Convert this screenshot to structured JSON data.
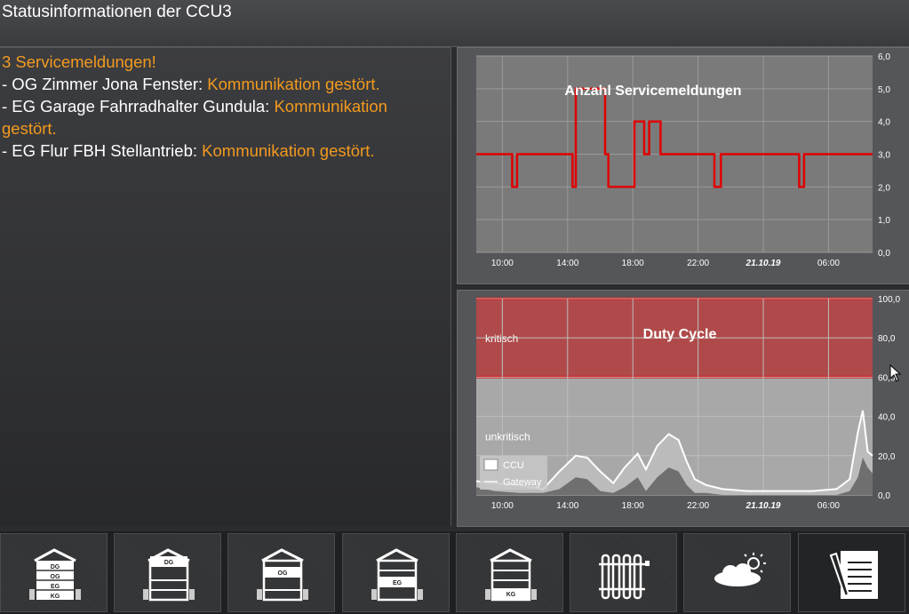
{
  "header": {
    "title": "Statusinformationen der CCU3"
  },
  "service": {
    "heading": "3 Servicemeldungen!",
    "items": [
      {
        "prefix": "- OG Zimmer Jona Fenster: ",
        "status": "Kommunikation gestört."
      },
      {
        "prefix": "- EG Garage Fahrradhalter Gundula: ",
        "status": "Kommunikation gestört."
      },
      {
        "prefix": "- EG Flur FBH Stellantrieb: ",
        "status": "Kommunikation gestört."
      }
    ]
  },
  "colors": {
    "accent": "#f39a1e",
    "line": "#e00000",
    "critical_zone": "#b04a4a",
    "ccu_line": "#ffffff",
    "gateway_area": "#6f6f6f"
  },
  "chart_data": [
    {
      "type": "line",
      "title": "Anzahl Servicemeldungen",
      "x_tick_labels": [
        "10:00",
        "14:00",
        "18:00",
        "22:00",
        "21.10.19",
        "06:00"
      ],
      "y_tick_labels": [
        "0,0",
        "1,0",
        "2,0",
        "3,0",
        "4,0",
        "5,0",
        "6,0"
      ],
      "ylim": [
        0,
        6
      ],
      "xlim": [
        8.4,
        32.7
      ],
      "grid": true,
      "series": [
        {
          "x": [
            8.4,
            10.6,
            10.6,
            10.9,
            10.9,
            14.3,
            14.3,
            14.5,
            14.5,
            16.3,
            16.3,
            16.5,
            16.5,
            18.1,
            18.1,
            18.7,
            18.7,
            19.0,
            19.0,
            19.7,
            19.7,
            19.8,
            19.8,
            23.0,
            23.0,
            23.4,
            23.4,
            28.2,
            28.2,
            28.5,
            28.5,
            32.7
          ],
          "y": [
            3,
            3,
            2,
            2,
            3,
            3,
            2,
            2,
            5,
            5,
            3,
            3,
            2,
            2,
            4,
            4,
            3,
            3,
            4,
            4,
            3,
            3,
            3,
            3,
            2,
            2,
            3,
            3,
            2,
            2,
            3,
            3
          ]
        }
      ]
    },
    {
      "type": "area",
      "title": "Duty Cycle",
      "zones": [
        {
          "label": "kritisch",
          "from": 60,
          "to": 100
        },
        {
          "label": "unkritisch",
          "from": 0,
          "to": 60
        }
      ],
      "x_tick_labels": [
        "10:00",
        "14:00",
        "18:00",
        "22:00",
        "21.10.19",
        "06:00"
      ],
      "y_tick_labels": [
        "0,0",
        "20,0",
        "40,0",
        "60,0",
        "80,0",
        "100,0"
      ],
      "ylim": [
        0,
        100
      ],
      "xlim": [
        8.4,
        32.7
      ],
      "legend": "bottom-left",
      "series": [
        {
          "name": "CCU",
          "x": [
            8.4,
            9.5,
            11,
            12.5,
            13.5,
            14.5,
            15.2,
            16,
            16.8,
            17.5,
            18.3,
            18.8,
            19.5,
            20.2,
            20.8,
            21.3,
            21.8,
            22.5,
            23.5,
            25,
            27,
            29,
            30.5,
            31.3,
            31.8,
            32.1,
            32.4,
            32.7
          ],
          "y": [
            7,
            6,
            5,
            3,
            12,
            20,
            19,
            12,
            6,
            14,
            21,
            13,
            25,
            31,
            28,
            17,
            8,
            5,
            3,
            2,
            2,
            2,
            3,
            8,
            32,
            43,
            22,
            20
          ]
        },
        {
          "name": "Gateway",
          "x": [
            8.4,
            9.5,
            11,
            12.5,
            13.5,
            14.5,
            15.2,
            16,
            16.8,
            17.5,
            18.3,
            18.8,
            19.5,
            20.2,
            20.8,
            21.3,
            21.8,
            22.5,
            23.5,
            25,
            27,
            29,
            30.5,
            31.3,
            31.8,
            32.1,
            32.4,
            32.7
          ],
          "y": [
            4,
            2,
            1,
            1,
            3,
            9,
            8,
            2,
            1,
            4,
            9,
            2,
            9,
            14,
            12,
            5,
            1,
            1,
            0,
            0,
            0,
            0,
            0,
            2,
            9,
            19,
            14,
            11
          ]
        }
      ]
    }
  ],
  "nav": [
    {
      "icon": "house-all-floors-icon",
      "floors": [
        "DG",
        "OG",
        "EG",
        "KG"
      ]
    },
    {
      "icon": "house-dg-icon",
      "floor": "DG"
    },
    {
      "icon": "house-og-icon",
      "floor": "OG"
    },
    {
      "icon": "house-eg-icon",
      "floor": "EG"
    },
    {
      "icon": "house-kg-icon",
      "floor": "KG"
    },
    {
      "icon": "radiator-icon"
    },
    {
      "icon": "weather-icon"
    },
    {
      "icon": "notes-icon"
    }
  ]
}
